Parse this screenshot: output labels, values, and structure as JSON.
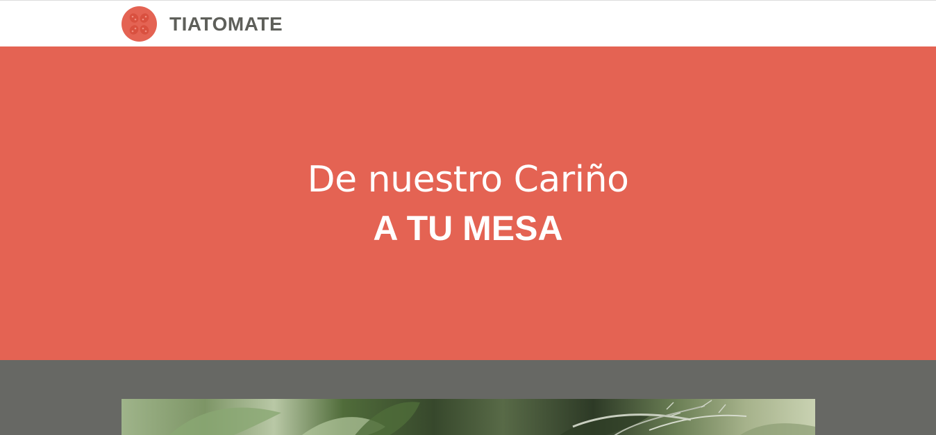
{
  "header": {
    "brand_name": "TIATOMATE",
    "logo_icon": "tomato-icon",
    "accent_color": "#e46353"
  },
  "hero": {
    "line1": "De nuestro Cariño",
    "line2": "A TU MESA",
    "background_color": "#e46353"
  },
  "band": {
    "background_color": "#676864",
    "image_subject": "tomato-plant-photo"
  }
}
